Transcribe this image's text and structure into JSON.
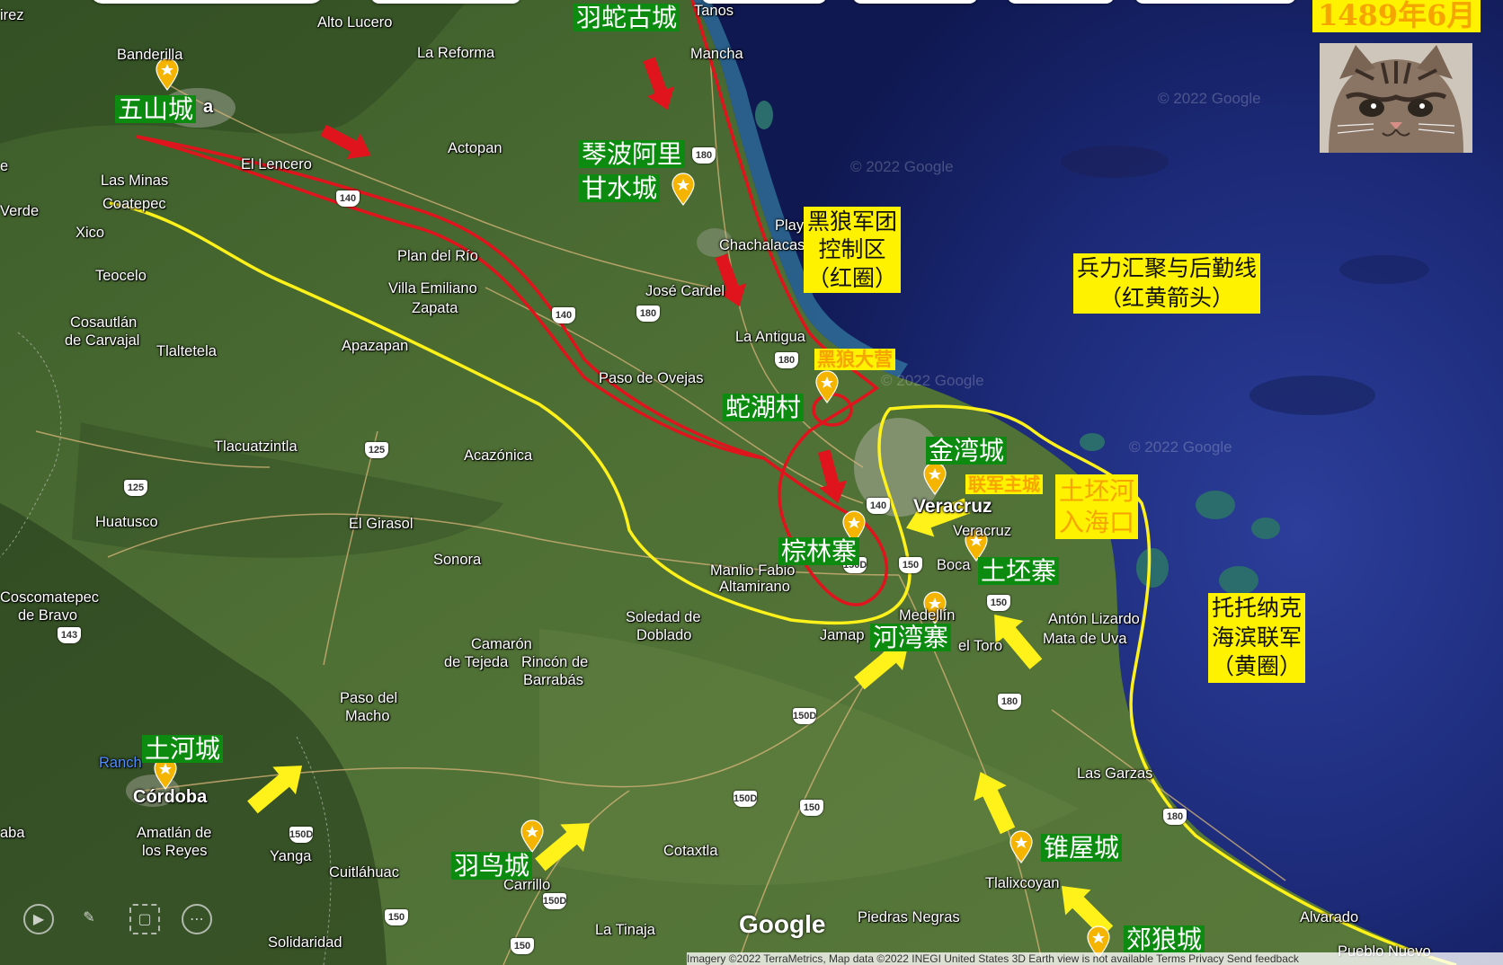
{
  "date_label": "1489年6月",
  "legend": {
    "red_zone_1": "黑狼军团",
    "red_zone_2": "控制区",
    "red_zone_3": "（红圈）",
    "arrows_1": "兵力汇聚与后勤线",
    "arrows_2": "（红黄箭头）",
    "yellow_zone_1": "托托纳克",
    "yellow_zone_2": "海滨联军",
    "yellow_zone_3": "（黄圈）",
    "river_mouth_1": "土坯河",
    "river_mouth_2": "入海口"
  },
  "cities": {
    "wushan": "五山城",
    "yushe": "羽蛇古城",
    "qinbo_1": "琴波阿里",
    "qinbo_2": "甘水城",
    "shehu": "蛇湖村",
    "heilang_camp": "黑狼大营",
    "jinwan": "金湾城",
    "lianjun": "联军主城",
    "zonglin": "棕林寨",
    "tupi": "土坯寨",
    "hewan": "河湾寨",
    "tuhe": "土河城",
    "yuniao": "羽鸟城",
    "zhuiwu": "锥屋城",
    "jiaolang": "郊狼城"
  },
  "places": {
    "alto_lucero": "Alto Lucero",
    "la_reforma": "La Reforma",
    "tanos": "Tanos",
    "mancha": "Mancha",
    "banderilla": "Banderilla",
    "xalapa_frag": "a",
    "actopan": "Actopan",
    "el_lencero": "El Lencero",
    "las_minas": "Las Minas",
    "coatepec": "Coatepec",
    "verde": "Verde",
    "xico": "Xico",
    "playa_1": "Playa",
    "playa_2": "Chachalacas",
    "plan_del_rio": "Plan del Río",
    "teocelo": "Teocelo",
    "villa_emiliano_1": "Villa Emiliano",
    "villa_emiliano_2": "Zapata",
    "jose_cardel": "José Cardel",
    "cosautlan_1": "Cosautlán",
    "cosautlan_2": "de Carvajal",
    "la_antigua": "La Antigua",
    "apazapan": "Apazapan",
    "tlaltetela": "Tlaltetela",
    "paso_de_ovejas": "Paso de Ovejas",
    "tlacuatzintla": "Tlacuatzintla",
    "acazonica": "Acazónica",
    "veracruz_big": "Veracruz",
    "veracruz_small": "Veracruz",
    "huatusco": "Huatusco",
    "el_girasol": "El Girasol",
    "sonora": "Sonora",
    "boca": "Boca",
    "manlio_1": "Manlio Fabio",
    "manlio_2": "Altamirano",
    "coscomatepec_1": "Coscomatepec",
    "coscomatepec_2": "de Bravo",
    "soledad_1": "Soledad de",
    "soledad_2": "Doblado",
    "anton_lizardo": "Antón Lizardo",
    "mata_de_uva": "Mata de Uva",
    "medellin": "Medellín",
    "jamap": "Jamap",
    "el_toro": "el Toro",
    "camaron_1": "Camarón",
    "camaron_2": "de Tejeda",
    "rincon_1": "Rincón de",
    "rincon_2": "Barrabás",
    "paso_del_macho_1": "Paso del",
    "paso_del_macho_2": "Macho",
    "rancho": "Ranch",
    "cordoba": "Córdoba",
    "las_garzas": "Las Garzas",
    "amatlan_1": "Amatlán de",
    "amatlan_2": "los Reyes",
    "yanga": "Yanga",
    "cuitlahuac": "Cuitláhuac",
    "cotaxtla": "Cotaxtla",
    "carrillo": "Carrillo",
    "tlalixcoyan": "Tlalixcoyan",
    "piedras_negras": "Piedras Negras",
    "alvarado": "Alvarado",
    "solidaridad": "Solidaridad",
    "la_tinaja": "La Tinaja",
    "pueblo_nuevo": "Pueblo Nuevo",
    "aba_frag": "aba",
    "irez_frag": "irez",
    "e_frag": "e"
  },
  "shields": {
    "s180a": "180",
    "s180b": "180",
    "s180c": "180",
    "s180d": "180",
    "s140a": "140",
    "s140b": "140",
    "s140c": "140",
    "s125a": "125",
    "s125b": "125",
    "s143": "143",
    "s150a": "150",
    "s150b": "150",
    "s150c": "150",
    "s150d": "150",
    "s150da": "150D",
    "s150db": "150D",
    "s150dc": "150D",
    "s150dd": "150D",
    "s150de": "150D"
  },
  "watermark": "© 2022 Google",
  "google_logo": "Google",
  "attribution": "Imagery ©2022 TerraMetrics, Map data ©2022 INEGI    United States    3D Earth view is not available    Terms    Privacy    Send feedback",
  "colors": {
    "red_line": "#e0141c",
    "yellow_line": "#fff21a",
    "label_green": "#0d8a10",
    "label_yellow": "#fff200",
    "label_orange": "#f5a400",
    "pin": "#f4b400"
  },
  "icons": [
    "play-icon",
    "pen-icon",
    "screenshot-icon",
    "more-icon",
    "pin-icon",
    "arrow-icon"
  ]
}
